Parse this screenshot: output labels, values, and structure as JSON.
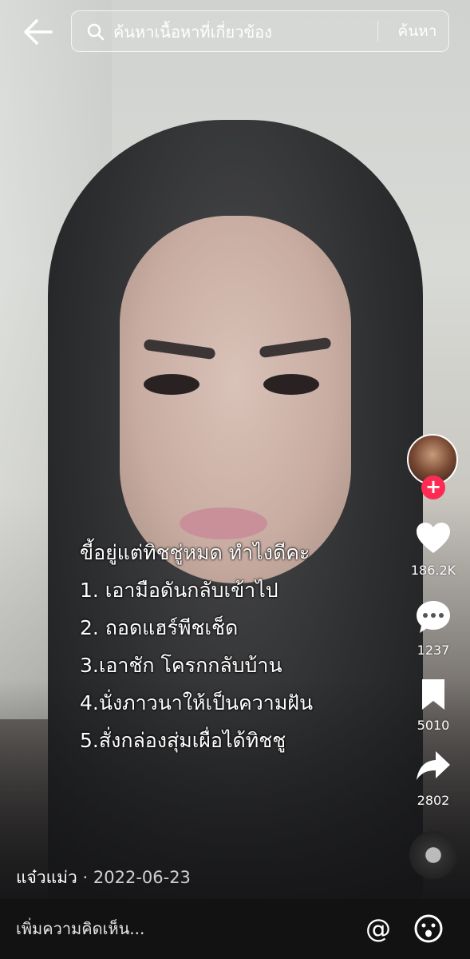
{
  "search": {
    "placeholder": "ค้นหาเนื้อหาที่เกี่ยวข้อง",
    "button_label": "ค้นหา"
  },
  "overlay_text": [
    "ขี้อยู่แต่ทิชชู่หมด ทำไงดีคะ",
    "1. เอามือดันกลับเข้าไป",
    "2. ถอดแฮร์พีชเช็ด",
    "3.เอาชัก โครกกลับบ้าน",
    "4.นั่งภาวนาให้เป็นความฝัน",
    "5.สั่งกล่องสุ่มเผื่อได้ทิชชู"
  ],
  "actions": {
    "likes": "186.2K",
    "comments": "1237",
    "saves": "5010",
    "shares": "2802"
  },
  "post": {
    "author": "แจ๋วแม่ว",
    "separator": "·",
    "date": "2022-06-23"
  },
  "comment": {
    "placeholder": "เพิ่มความคิดเห็น..."
  },
  "icons": {
    "back": "back-arrow-icon",
    "search": "search-icon",
    "like": "heart-icon",
    "comment": "comment-bubble-icon",
    "save": "bookmark-icon",
    "share": "share-arrow-icon",
    "mention": "at-sign-icon",
    "emoji": "emoji-icon"
  },
  "colors": {
    "follow_button": "#fe2c55",
    "comment_bar": "#121212"
  }
}
